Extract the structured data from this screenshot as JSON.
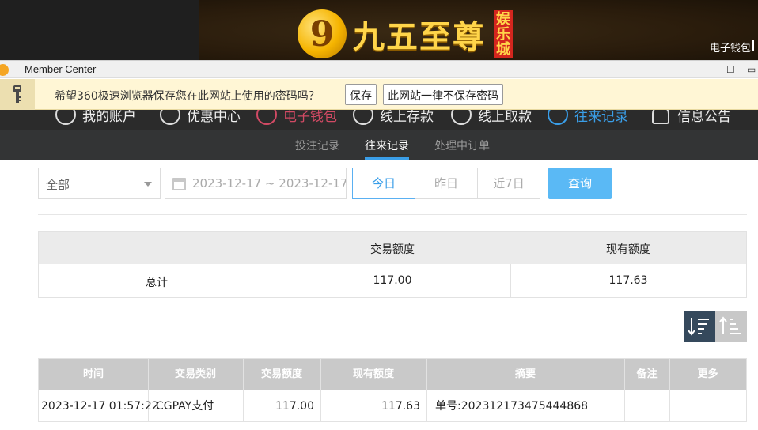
{
  "banner": {
    "logo_mark": "9",
    "logo_text": "九五至尊",
    "logo_tag": "娱乐城",
    "wallet_link": "电子钱包"
  },
  "window": {
    "title": "Member Center",
    "minimize": "—",
    "maximize": "☐"
  },
  "password_prompt": {
    "message": "希望360极速浏览器保存您在此网站上使用的密码吗？",
    "save_label": "保存",
    "never_label": "此网站一律不保存密码"
  },
  "main_nav": {
    "items": [
      {
        "label": "我的账户",
        "icon": "user-icon"
      },
      {
        "label": "优惠中心",
        "icon": "gift-icon"
      },
      {
        "label": "电子钱包",
        "icon": "wallet-icon"
      },
      {
        "label": "线上存款",
        "icon": "deposit-icon"
      },
      {
        "label": "线上取款",
        "icon": "withdraw-icon"
      },
      {
        "label": "往来记录",
        "icon": "record-icon"
      },
      {
        "label": "信息公告",
        "icon": "bell-icon"
      }
    ]
  },
  "sub_nav": {
    "items": [
      "投注记录",
      "往来记录",
      "处理中订单"
    ],
    "active": "往来记录"
  },
  "filters": {
    "type_select": "全部",
    "date_range": "2023-12-17 ~ 2023-12-17",
    "today": "今日",
    "yesterday": "昨日",
    "last7": "近7日",
    "query": "查询"
  },
  "summary": {
    "headers": [
      "",
      "交易额度",
      "现有额度"
    ],
    "row": {
      "label": "总计",
      "amount": "117.00",
      "balance": "117.63"
    }
  },
  "detail": {
    "headers": [
      "时间",
      "交易类别",
      "交易额度",
      "现有额度",
      "摘要",
      "备注",
      "更多"
    ],
    "rows": [
      {
        "time": "2023-12-17 01:57:22",
        "type": "CGPAY支付",
        "amount": "117.00",
        "balance": "117.63",
        "summary": "单号:202312173475444868",
        "note": "",
        "more": ""
      }
    ]
  },
  "colors": {
    "accent": "#3a9ee8",
    "query_button": "#5ab9f5",
    "nav_bg": "#2b2b2b",
    "sort_active": "#35495c"
  }
}
